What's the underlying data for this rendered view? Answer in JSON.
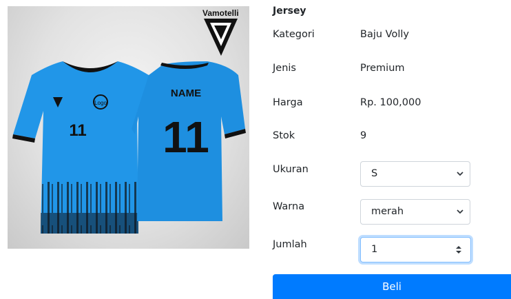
{
  "product": {
    "brand": "Vamotelli",
    "jersey_name": "NAME",
    "jersey_number": "11",
    "chest_logo": "Logo",
    "brand_icon": "vamotelli-v-logo-icon",
    "main_color": "#2196e8"
  },
  "details": {
    "title": "Jersey",
    "fields": [
      {
        "label": "Kategori",
        "value": "Baju Volly"
      },
      {
        "label": "Jenis",
        "value": "Premium"
      },
      {
        "label": "Harga",
        "value": "Rp. 100,000"
      },
      {
        "label": "Stok",
        "value": "9"
      }
    ]
  },
  "form": {
    "size_label": "Ukuran",
    "size_value": "S",
    "color_label": "Warna",
    "color_value": "merah",
    "qty_label": "Jumlah",
    "qty_value": "1",
    "buy_label": "Beli",
    "accent": "#007bff",
    "icons": {
      "select": "chevron-down-icon",
      "stepper": "spinner-arrows-icon"
    }
  }
}
